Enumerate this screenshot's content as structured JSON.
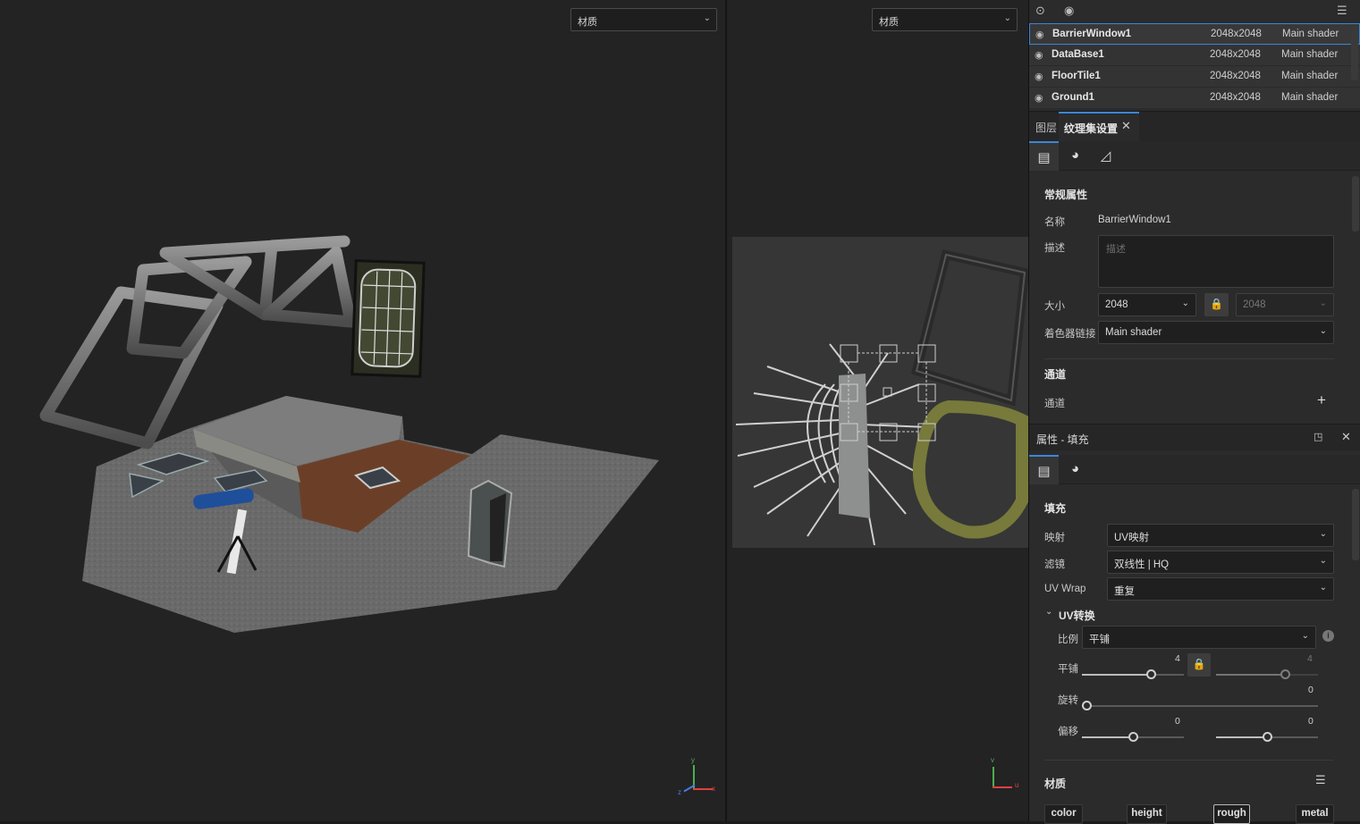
{
  "viewport3d": {
    "material_select": "材质",
    "axes": {
      "x": "x",
      "y": "y",
      "z": "z"
    }
  },
  "viewport2d": {
    "material_select": "材质",
    "axes": {
      "u": "u",
      "v": "v"
    }
  },
  "texture_sets": [
    {
      "name": "BarrierWindow1",
      "resolution": "2048x2048",
      "shader": "Main shader",
      "selected": true
    },
    {
      "name": "DataBase1",
      "resolution": "2048x2048",
      "shader": "Main shader",
      "selected": false
    },
    {
      "name": "FloorTile1",
      "resolution": "2048x2048",
      "shader": "Main shader",
      "selected": false
    },
    {
      "name": "Ground1",
      "resolution": "2048x2048",
      "shader": "Main shader",
      "selected": false
    }
  ],
  "tabs": {
    "layers": "图层",
    "texture_set_settings": "纹理集设置"
  },
  "settings": {
    "section_general": "常规属性",
    "name_label": "名称",
    "name_value": "BarrierWindow1",
    "desc_label": "描述",
    "desc_placeholder": "描述",
    "size_label": "大小",
    "size_value": "2048",
    "size_value_locked": "2048",
    "shader_link_label": "着色器链接",
    "shader_link_value": "Main shader",
    "section_channels": "通道",
    "channels_label": "通道"
  },
  "properties": {
    "title": "属性 - 填充",
    "section_fill": "填充",
    "mapping_label": "映射",
    "mapping_value": "UV映射",
    "filter_label": "滤镜",
    "filter_value": "双线性 | HQ",
    "uvwrap_label": "UV Wrap",
    "uvwrap_value": "重复",
    "uv_transform": "UV转换",
    "scale_label": "比例",
    "scale_value": "平铺",
    "tiling_label": "平铺",
    "tiling_u": "4",
    "tiling_v": "4",
    "rotation_label": "旋转",
    "rotation_value": "0",
    "offset_label": "偏移",
    "offset_u": "0",
    "offset_v": "0",
    "section_material": "材质",
    "material_chips": [
      "color",
      "height",
      "rough",
      "metal"
    ],
    "active_chip": "rough"
  },
  "slider_levels": {
    "tiling_u": 0.7,
    "tiling_v": 0.7,
    "rotation": 0.0,
    "offset_u": 0.5,
    "offset_v": 0.5
  },
  "colors": {
    "accent": "#3b86d8",
    "panel_bg": "#2b2b2b",
    "viewport_bg": "#232323"
  },
  "icons": [
    "camera-eye-icon",
    "eye-icon",
    "menu-icon",
    "visibility-eye-icon",
    "texture-settings-icon",
    "material-sphere-icon",
    "uv-frame-icon",
    "lock-icon",
    "add-icon",
    "info-icon",
    "close-icon",
    "float-panel-icon",
    "chip-menu-icon"
  ]
}
